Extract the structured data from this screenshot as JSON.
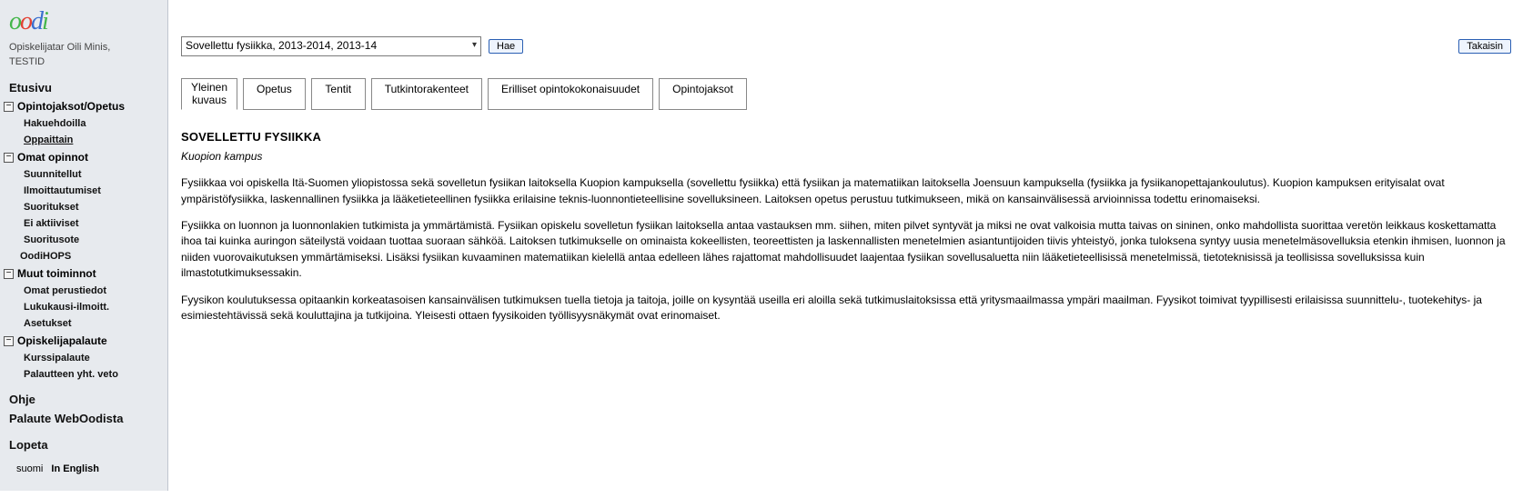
{
  "user_line_1": "Opiskelijatar Oili Minis,",
  "user_line_2": "TESTID",
  "sidebar": {
    "front": "Etusivu",
    "grp_courses": "Opintojaksot/Opetus",
    "hakuehdoilla": "Hakuehdoilla",
    "oppaittain": "Oppaittain",
    "grp_own": "Omat opinnot",
    "suunnitellut": "Suunnitellut",
    "ilmoitt": "Ilmoittautumiset",
    "suoritukset": "Suoritukset",
    "eiakt": "Ei aktiiviset",
    "suoritusote": "Suoritusote",
    "oodihops": "OodiHOPS",
    "grp_muut": "Muut toiminnot",
    "omatper": "Omat perustiedot",
    "lukuk": "Lukukausi-ilmoitt.",
    "asetukset": "Asetukset",
    "grp_pal": "Opiskelijapalaute",
    "kurssipal": "Kurssipalaute",
    "palveto": "Palautteen yht. veto",
    "ohje": "Ohje",
    "palaute": "Palaute WebOodista",
    "lopeta": "Lopeta",
    "lang_fi": "suomi",
    "lang_en": "In English"
  },
  "toolbar": {
    "select": "Sovellettu fysiikka, 2013-2014, 2013-14",
    "hae": "Hae",
    "takaisin": "Takaisin"
  },
  "tabs": {
    "t0a": "Yleinen",
    "t0b": "kuvaus",
    "t1": "Opetus",
    "t2": "Tentit",
    "t3": "Tutkintorakenteet",
    "t4": "Erilliset opintokokonaisuudet",
    "t5": "Opintojaksot"
  },
  "content": {
    "title": "SOVELLETTU FYSIIKKA",
    "subtitle": "Kuopion kampus",
    "p1": "Fysiikkaa voi opiskella Itä-Suomen yliopistossa sekä sovelletun fysiikan laitoksella Kuopion kampuksella (sovellettu fysiikka) että fysiikan ja matematiikan laitoksella Joensuun kampuksella (fysiikka ja fysiikanopettajankoulutus). Kuopion kampuksen erityisalat ovat ympäristöfysiikka, laskennallinen fysiikka ja lääketieteellinen fysiikka erilaisine teknis-luonnontieteellisine sovelluksineen. Laitoksen opetus perustuu tutkimukseen, mikä on kansainvälisessä arvioinnissa todettu erinomaiseksi.",
    "p2": "Fysiikka on luonnon ja luonnonlakien tutkimista ja ymmärtämistä. Fysiikan opiskelu sovelletun fysiikan laitoksella antaa vastauksen mm. siihen, miten pilvet syntyvät ja miksi ne ovat valkoisia mutta taivas on sininen, onko mahdollista suorittaa veretön leikkaus koskettamatta ihoa tai kuinka auringon säteilystä voidaan tuottaa suoraan sähköä. Laitoksen tutkimukselle on ominaista kokeellisten, teoreettisten ja laskennallisten menetelmien asiantuntijoiden tiivis yhteistyö, jonka tuloksena syntyy uusia menetelmäsovelluksia etenkin ihmisen, luonnon ja niiden vuorovaikutuksen ymmärtämiseksi. Lisäksi fysiikan kuvaaminen matematiikan kielellä antaa edelleen lähes rajattomat mahdollisuudet laajentaa fysiikan sovellusaluetta niin lääketieteellisissä menetelmissä, tietoteknisissä ja teollisissa sovelluksissa kuin ilmastotutkimuksessakin.",
    "p3": "Fyysikon koulutuksessa opitaankin korkeatasoisen kansainvälisen tutkimuksen tuella tietoja ja taitoja, joille on kysyntää useilla eri aloilla sekä tutkimuslaitoksissa että yritysmaailmassa ympäri maailman. Fyysikot toimivat tyypillisesti erilaisissa suunnittelu-, tuotekehitys- ja esimiestehtävissä sekä kouluttajina ja tutkijoina. Yleisesti ottaen fyysikoiden työllisyysnäkymät ovat erinomaiset."
  }
}
